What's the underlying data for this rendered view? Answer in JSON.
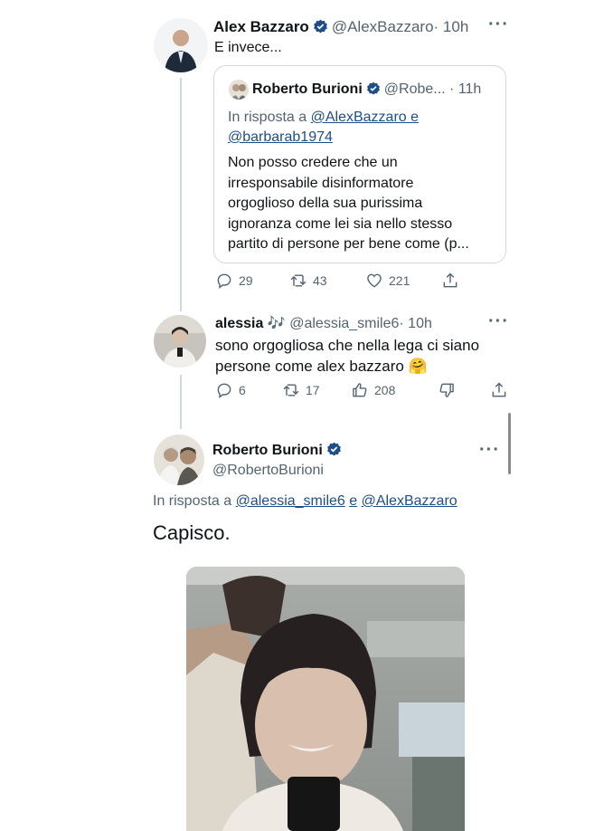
{
  "tweet1": {
    "name": "Alex Bazzaro",
    "handle": "@AlexBazzaro",
    "time": "· 10h",
    "text": "E invece...",
    "quote": {
      "name": "Roberto Burioni",
      "handle": "@Robe...",
      "time": "· 11h",
      "reply_prefix": "In risposta a",
      "reply_user1": "@AlexBazzaro e",
      "reply_user2": "@barbarab1974",
      "lines": [
        "Non posso credere che un",
        "irresponsabile disinformatore",
        "orgoglioso della sua purissima",
        "ignoranza come lei sia nello stesso",
        "partito di persone per bene come (p..."
      ]
    },
    "stats": {
      "replies": "29",
      "retweets": "43",
      "likes": "221"
    }
  },
  "tweet2": {
    "name": "alessia",
    "name_emoji": "🎶",
    "handle": "@alessia_smile6",
    "time": "· 10h",
    "lines": [
      "sono orgogliosa che nella lega ci siano",
      "persone come alex bazzaro 🤗"
    ],
    "stats": {
      "replies": "6",
      "retweets": "17",
      "likes": "208"
    }
  },
  "tweet3": {
    "name": "Roberto Burioni",
    "handle": "@RobertoBurioni",
    "reply_prefix": "In risposta a",
    "reply_user1": "@alessia_smile6",
    "reply_and": "e",
    "reply_user2": "@AlexBazzaro",
    "text": "Capisco."
  },
  "colors": {
    "verified": "#1d4e89",
    "text": "#0f1419",
    "muted": "#536471",
    "link": "#1d4e89",
    "border": "#cfd9de"
  }
}
